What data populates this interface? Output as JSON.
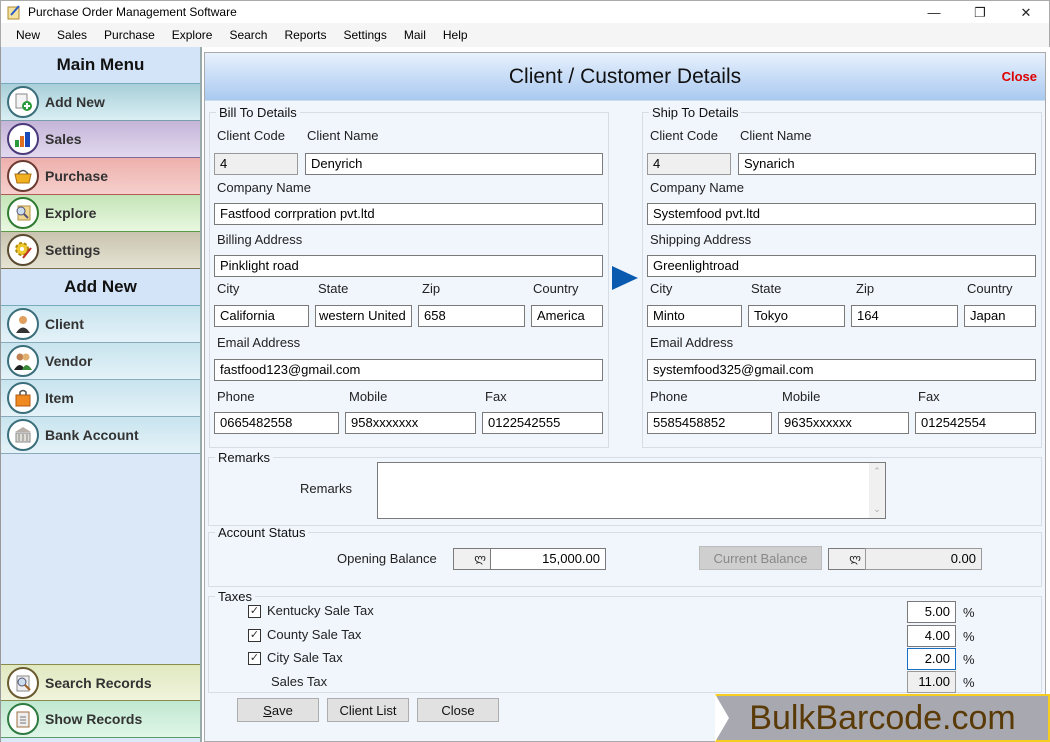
{
  "window": {
    "title": "Purchase Order Management Software",
    "controls": {
      "minimize": "—",
      "restore": "❐",
      "close": "✕"
    }
  },
  "menubar": [
    "New",
    "Sales",
    "Purchase",
    "Explore",
    "Search",
    "Reports",
    "Settings",
    "Mail",
    "Help"
  ],
  "sidebar": {
    "main_menu_title": "Main Menu",
    "main_items": [
      {
        "label": "Add New",
        "icon": "add-document-icon"
      },
      {
        "label": "Sales",
        "icon": "sales-chart-icon"
      },
      {
        "label": "Purchase",
        "icon": "basket-icon"
      },
      {
        "label": "Explore",
        "icon": "magnifier-document-icon"
      },
      {
        "label": "Settings",
        "icon": "gear-pen-icon"
      }
    ],
    "add_new_title": "Add New",
    "add_items": [
      {
        "label": "Client",
        "icon": "client-person-icon"
      },
      {
        "label": "Vendor",
        "icon": "vendor-people-icon"
      },
      {
        "label": "Item",
        "icon": "shopping-bag-icon"
      },
      {
        "label": "Bank Account",
        "icon": "bank-building-icon"
      }
    ],
    "bottom_items": [
      {
        "label": "Search Records",
        "icon": "search-clipboard-icon"
      },
      {
        "label": "Show Records",
        "icon": "clipboard-icon"
      }
    ]
  },
  "form": {
    "title": "Client / Customer Details",
    "close_link": "Close",
    "bill_to": {
      "legend": "Bill To Details",
      "client_code_label": "Client Code",
      "client_code": "4",
      "client_name_label": "Client Name",
      "client_name": "Denyrich",
      "company_name_label": "Company Name",
      "company_name": "Fastfood corrpration pvt.ltd",
      "address_label": "Billing Address",
      "address": "Pinklight road",
      "city_label": "City",
      "city": "California",
      "state_label": "State",
      "state": "western United",
      "zip_label": "Zip",
      "zip": "658",
      "country_label": "Country",
      "country": "America",
      "email_label": "Email Address",
      "email": "fastfood123@gmail.com",
      "phone_label": "Phone",
      "phone": "0665482558",
      "mobile_label": "Mobile",
      "mobile": "958xxxxxxx",
      "fax_label": "Fax",
      "fax": "0122542555"
    },
    "ship_to": {
      "legend": "Ship To Details",
      "client_code_label": "Client Code",
      "client_code": "4",
      "client_name_label": "Client Name",
      "client_name": "Synarich",
      "company_name_label": "Company Name",
      "company_name": "Systemfood pvt.ltd",
      "address_label": "Shipping Address",
      "address": "Greenlightroad",
      "city_label": "City",
      "city": "Minto",
      "state_label": "State",
      "state": "Tokyo",
      "zip_label": "Zip",
      "zip": "164",
      "country_label": "Country",
      "country": "Japan",
      "email_label": "Email Address",
      "email": "systemfood325@gmail.com",
      "phone_label": "Phone",
      "phone": "5585458852",
      "mobile_label": "Mobile",
      "mobile": "9635xxxxxx",
      "fax_label": "Fax",
      "fax": "012542554"
    },
    "remarks": {
      "legend": "Remarks",
      "label": "Remarks",
      "value": ""
    },
    "account_status": {
      "legend": "Account Status",
      "opening_balance_label": "Opening Balance",
      "currency_symbol": "ლ",
      "opening_balance": "15,000.00",
      "current_balance_button": "Current Balance",
      "current_balance": "0.00"
    },
    "taxes": {
      "legend": "Taxes",
      "items": [
        {
          "label": "Kentucky Sale Tax",
          "checked": true,
          "value": "5.00"
        },
        {
          "label": "County Sale Tax",
          "checked": true,
          "value": "4.00"
        },
        {
          "label": "City Sale Tax",
          "checked": true,
          "value": "2.00"
        }
      ],
      "total_label": "Sales Tax",
      "total": "11.00",
      "percent_sign": "%"
    },
    "buttons": {
      "save_mnemonic": "S",
      "save_rest": "ave",
      "client_list": "Client List",
      "close": "Close"
    }
  },
  "watermark": "BulkBarcode.com",
  "colors": {
    "close_link": "#dd0000",
    "arrow": "#0a5bb0",
    "watermark_border": "#f5cc20",
    "watermark_text": "#5a3a06"
  }
}
